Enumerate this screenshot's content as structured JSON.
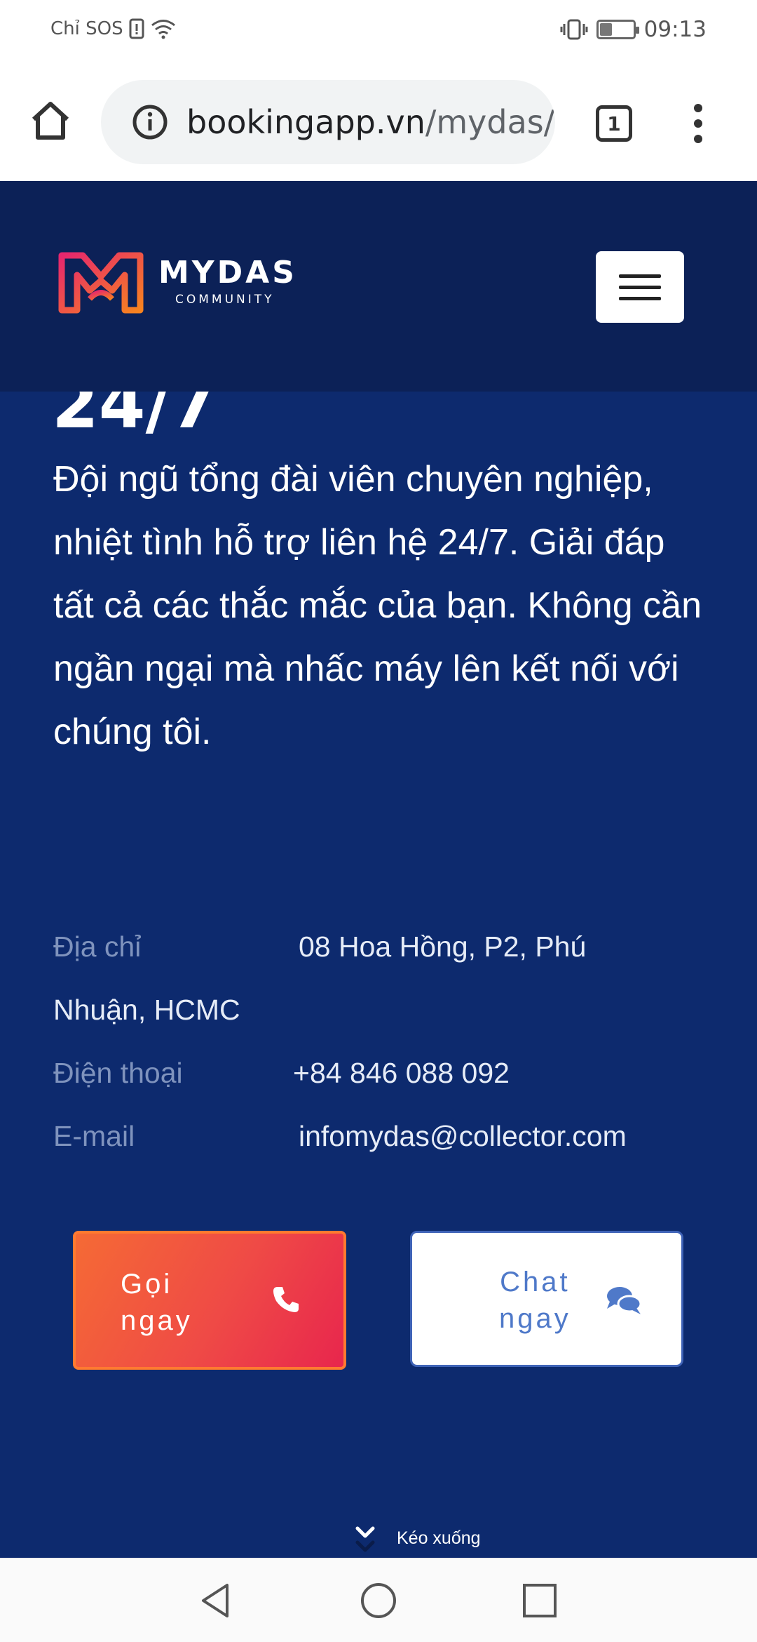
{
  "status_bar": {
    "carrier": "Chỉ SOS",
    "time": "09:13",
    "battery_level": 0.35
  },
  "browser": {
    "url_host": "bookingapp.vn",
    "url_path": "/mydas/",
    "tab_count": "1"
  },
  "header": {
    "logo_name": "MYDAS",
    "logo_sub": "COMMUNITY"
  },
  "content": {
    "cut_heading": "24/7",
    "description": "Đội ngũ tổng đài viên chuyên nghiệp, nhiệt tình hỗ trợ liên hệ 24/7. Giải đáp tất cả các thắc mắc của bạn. Không cần ngần ngại mà nhấc máy lên kết nối với chúng tôi."
  },
  "contact": {
    "address_label": "Địa chỉ",
    "address_line1": "08 Hoa Hồng, P2, Phú",
    "address_line2": "Nhuận, HCMC",
    "phone_label": "Điện thoại",
    "phone_value": "+84 846 088 092",
    "email_label": "E-mail",
    "email_value": "infomydas@collector.com"
  },
  "buttons": {
    "call_line1": "Gọi",
    "call_line2": "ngay",
    "chat_line1": "Chat",
    "chat_line2": "ngay"
  },
  "scroll_hint": "Kéo xuống",
  "icons": {
    "phone": "phone-icon",
    "chat": "chat-bubbles-icon",
    "home": "home-icon",
    "info": "info-icon"
  },
  "colors": {
    "page_bg": "#0d2a6e",
    "header_bg": "#0c2157",
    "call_gradient_start": "#f56a35",
    "call_gradient_end": "#e8264d",
    "chat_accent": "#4f79c9"
  }
}
